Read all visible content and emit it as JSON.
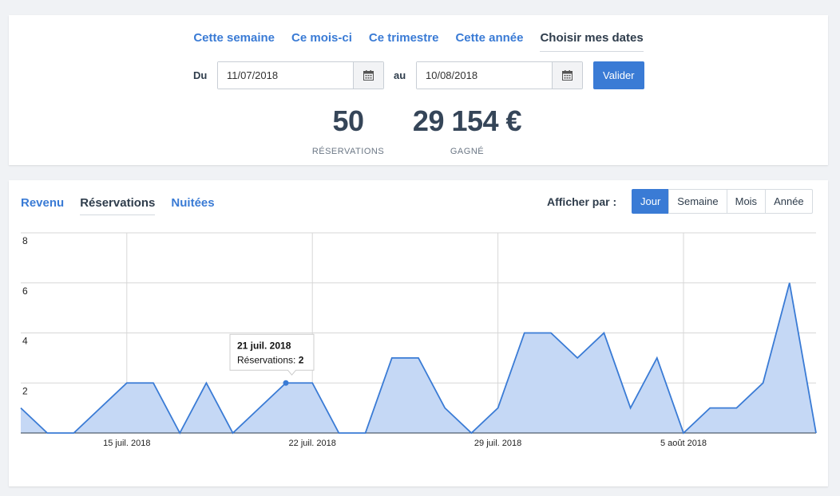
{
  "period_tabs": [
    {
      "label": "Cette semaine",
      "active": false
    },
    {
      "label": "Ce mois-ci",
      "active": false
    },
    {
      "label": "Ce trimestre",
      "active": false
    },
    {
      "label": "Cette année",
      "active": false
    },
    {
      "label": "Choisir mes dates",
      "active": true
    }
  ],
  "date_range": {
    "from_label": "Du",
    "from_value": "11/07/2018",
    "to_label": "au",
    "to_value": "10/08/2018",
    "submit_label": "Valider"
  },
  "stats": {
    "reservations": {
      "value": "50",
      "label": "RÉSERVATIONS"
    },
    "earned": {
      "value": "29 154 €",
      "label": "GAGNÉ"
    }
  },
  "metric_tabs": [
    {
      "label": "Revenu",
      "active": false
    },
    {
      "label": "Réservations",
      "active": true
    },
    {
      "label": "Nuitées",
      "active": false
    }
  ],
  "granularity": {
    "label": "Afficher par :",
    "options": [
      {
        "label": "Jour",
        "active": true
      },
      {
        "label": "Semaine",
        "active": false
      },
      {
        "label": "Mois",
        "active": false
      },
      {
        "label": "Année",
        "active": false
      }
    ]
  },
  "colors": {
    "accent": "#3a7bd5",
    "area_fill": "#c5d8f5",
    "area_stroke": "#3a7bd5"
  },
  "icons": {
    "calendar": "calendar-icon"
  },
  "chart_data": {
    "type": "area",
    "x": [
      "2018-07-11",
      "2018-07-12",
      "2018-07-13",
      "2018-07-14",
      "2018-07-15",
      "2018-07-16",
      "2018-07-17",
      "2018-07-18",
      "2018-07-19",
      "2018-07-20",
      "2018-07-21",
      "2018-07-22",
      "2018-07-23",
      "2018-07-24",
      "2018-07-25",
      "2018-07-26",
      "2018-07-27",
      "2018-07-28",
      "2018-07-29",
      "2018-07-30",
      "2018-07-31",
      "2018-08-01",
      "2018-08-02",
      "2018-08-03",
      "2018-08-04",
      "2018-08-05",
      "2018-08-06",
      "2018-08-07",
      "2018-08-08",
      "2018-08-09",
      "2018-08-10"
    ],
    "series": [
      {
        "values": [
          1,
          0,
          0,
          1,
          2,
          2,
          0,
          2,
          0,
          1,
          2,
          2,
          0,
          0,
          3,
          3,
          1,
          0,
          1,
          4,
          4,
          3,
          4,
          1,
          3,
          0,
          1,
          1,
          2,
          6,
          0
        ]
      }
    ],
    "ylim": [
      0,
      8
    ],
    "yticks": [
      "2",
      "4",
      "6",
      "8"
    ],
    "xtick_labels": [
      {
        "date": "2018-07-15",
        "label": "15 juil. 2018"
      },
      {
        "date": "2018-07-22",
        "label": "22 juil. 2018"
      },
      {
        "date": "2018-07-29",
        "label": "29 juil. 2018"
      },
      {
        "date": "2018-08-05",
        "label": "5 août 2018"
      }
    ],
    "grid": true,
    "tooltip": {
      "date": "2018-07-21",
      "title": "21 juil. 2018",
      "series_label": "Réservations: ",
      "value": "2"
    }
  }
}
